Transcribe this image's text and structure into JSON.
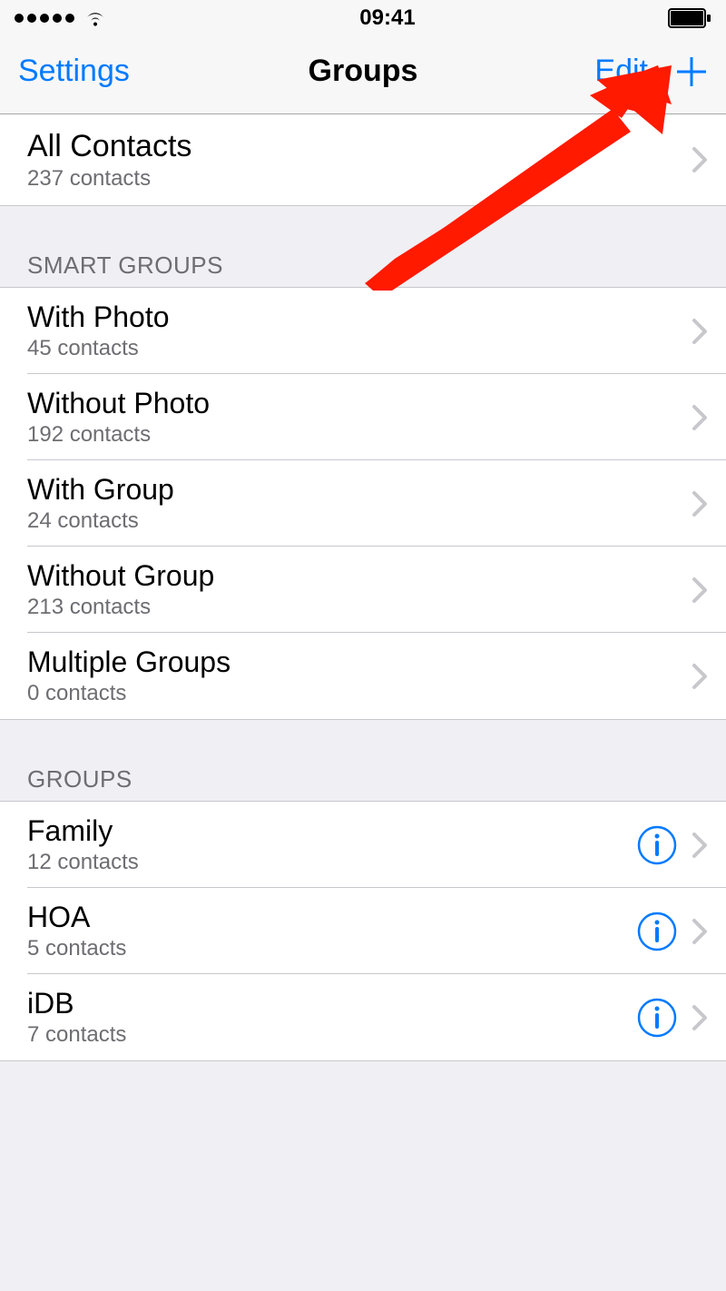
{
  "status": {
    "time": "09:41"
  },
  "nav": {
    "back_label": "Settings",
    "title": "Groups",
    "edit_label": "Edit"
  },
  "all_contacts": {
    "title": "All Contacts",
    "subtitle": "237 contacts"
  },
  "sections": {
    "smart_groups_header": "SMART GROUPS",
    "groups_header": "GROUPS"
  },
  "smart_groups": [
    {
      "title": "With Photo",
      "subtitle": "45 contacts"
    },
    {
      "title": "Without Photo",
      "subtitle": "192 contacts"
    },
    {
      "title": "With Group",
      "subtitle": "24 contacts"
    },
    {
      "title": "Without Group",
      "subtitle": "213 contacts"
    },
    {
      "title": "Multiple Groups",
      "subtitle": "0 contacts"
    }
  ],
  "groups": [
    {
      "title": "Family",
      "subtitle": "12 contacts"
    },
    {
      "title": "HOA",
      "subtitle": "5 contacts"
    },
    {
      "title": "iDB",
      "subtitle": "7 contacts"
    }
  ]
}
